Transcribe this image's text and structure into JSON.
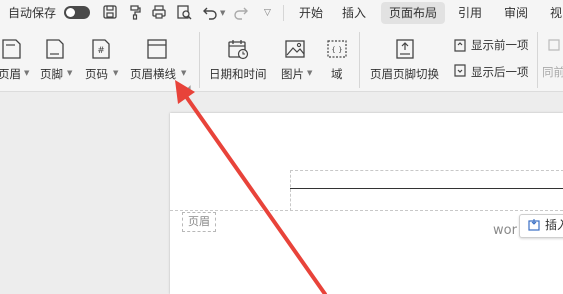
{
  "quick_access": {
    "autosave_label": "自动保存"
  },
  "tabs": [
    "开始",
    "插入",
    "页面布局",
    "引用",
    "审阅",
    "视"
  ],
  "active_tab": "页面布局",
  "ribbon": {
    "items": [
      {
        "label": "页眉",
        "has_dropdown": true
      },
      {
        "label": "页脚",
        "has_dropdown": true
      },
      {
        "label": "页码",
        "has_dropdown": true
      },
      {
        "label": "页眉横线",
        "has_dropdown": true
      },
      {
        "label": "日期和时间",
        "has_dropdown": false
      },
      {
        "label": "图片",
        "has_dropdown": true
      },
      {
        "label": "域",
        "has_dropdown": false
      },
      {
        "label": "页眉页脚切换",
        "has_dropdown": false
      }
    ],
    "show_prev_label": "显示前一项",
    "show_next_label": "显示后一项",
    "cut_label": "同前"
  },
  "document": {
    "header_tag": "页眉",
    "insert_button_label": "插入",
    "body_text_fragment": "wor"
  },
  "colors": {
    "annotation_arrow": "#e8433a",
    "toggle": "#4a4a4a"
  }
}
